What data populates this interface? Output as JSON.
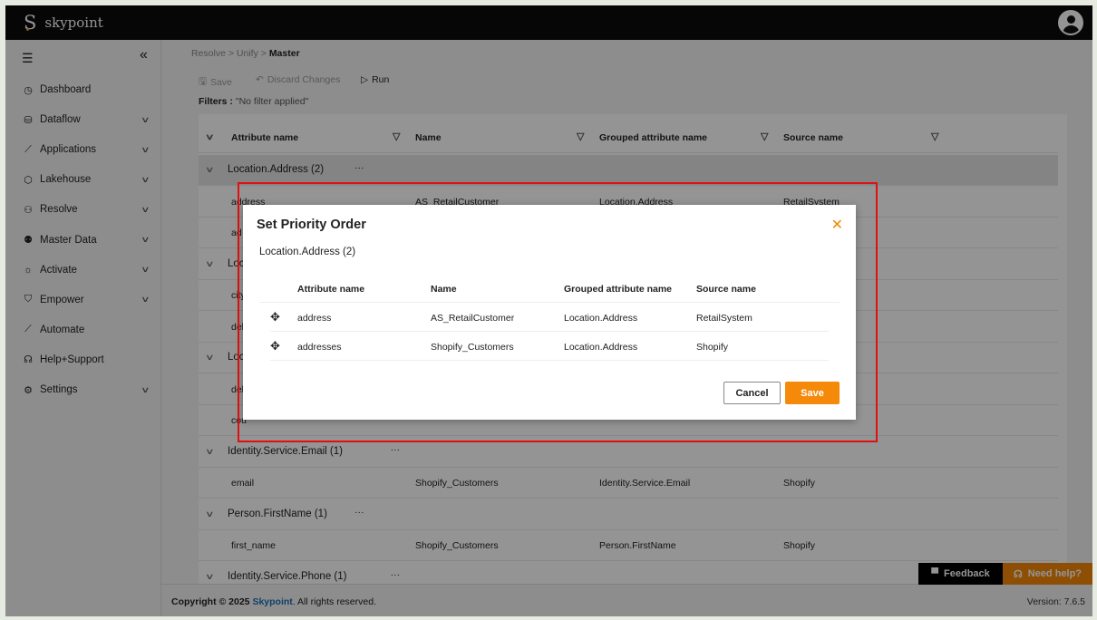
{
  "app": {
    "name": "skypoint",
    "logo_letter": "S"
  },
  "sidebar": {
    "items": [
      {
        "label": "Dashboard",
        "icon": "gauge-icon",
        "glyph": "◷",
        "chevron": false
      },
      {
        "label": "Dataflow",
        "icon": "database-icon",
        "glyph": "⛁",
        "chevron": true
      },
      {
        "label": "Applications",
        "icon": "connector-icon",
        "glyph": "⟋",
        "chevron": true
      },
      {
        "label": "Lakehouse",
        "icon": "cube-icon",
        "glyph": "⬡",
        "chevron": true
      },
      {
        "label": "Resolve",
        "icon": "hierarchy-icon",
        "glyph": "⚇",
        "chevron": true
      },
      {
        "label": "Master Data",
        "icon": "people-icon",
        "glyph": "⚉",
        "chevron": true
      },
      {
        "label": "Activate",
        "icon": "lightbulb-icon",
        "glyph": "☼",
        "chevron": true
      },
      {
        "label": "Empower",
        "icon": "shield-icon",
        "glyph": "⛉",
        "chevron": true
      },
      {
        "label": "Automate",
        "icon": "connector-icon",
        "glyph": "⟋",
        "chevron": false
      },
      {
        "label": "Help+Support",
        "icon": "headset-icon",
        "glyph": "☊",
        "chevron": false
      },
      {
        "label": "Settings",
        "icon": "gear-icon",
        "glyph": "⚙",
        "chevron": true
      }
    ]
  },
  "breadcrumb": {
    "items": [
      "Resolve",
      "Unify"
    ],
    "current": "Master"
  },
  "toolbar": {
    "save": "Save",
    "discard": "Discard Changes",
    "run": "Run"
  },
  "filters": {
    "label": "Filters :",
    "value": "\"No filter applied\""
  },
  "table": {
    "columns": [
      "Attribute name",
      "Name",
      "Grouped attribute name",
      "Source name"
    ],
    "rows": [
      {
        "type": "group",
        "label": "Location.Address (2)"
      },
      {
        "type": "row",
        "cells": [
          "address",
          "AS_RetailCustomer",
          "Location.Address",
          "RetailSystem"
        ]
      },
      {
        "type": "row",
        "cells": [
          "ad",
          "",
          "",
          ""
        ]
      },
      {
        "type": "group",
        "label": "Loc"
      },
      {
        "type": "row",
        "cells": [
          "city",
          "",
          "",
          ""
        ]
      },
      {
        "type": "row",
        "cells": [
          "del",
          "",
          "",
          ""
        ]
      },
      {
        "type": "group",
        "label": "Loc"
      },
      {
        "type": "row",
        "cells": [
          "del",
          "",
          "",
          ""
        ]
      },
      {
        "type": "row",
        "cells": [
          "cou",
          "",
          "",
          ""
        ]
      },
      {
        "type": "group",
        "label": "Identity.Service.Email (1)"
      },
      {
        "type": "row",
        "cells": [
          "email",
          "Shopify_Customers",
          "Identity.Service.Email",
          "Shopify"
        ]
      },
      {
        "type": "group",
        "label": "Person.FirstName (1)"
      },
      {
        "type": "row",
        "cells": [
          "first_name",
          "Shopify_Customers",
          "Person.FirstName",
          "Shopify"
        ]
      },
      {
        "type": "group",
        "label": "Identity.Service.Phone (1)"
      }
    ]
  },
  "modal": {
    "title": "Set Priority Order",
    "subtitle": "Location.Address (2)",
    "columns": [
      "Attribute name",
      "Name",
      "Grouped attribute name",
      "Source name"
    ],
    "rows": [
      [
        "address",
        "AS_RetailCustomer",
        "Location.Address",
        "RetailSystem"
      ],
      [
        "addresses",
        "Shopify_Customers",
        "Location.Address",
        "Shopify"
      ]
    ],
    "cancel": "Cancel",
    "save": "Save"
  },
  "footer": {
    "copyright_prefix": "Copyright © 2025 ",
    "brand": "Skypoint",
    "copyright_suffix": ". All rights reserved.",
    "version": "Version: 7.6.5"
  },
  "widgets": {
    "feedback": "Feedback",
    "help": "Need help?"
  },
  "colors": {
    "accent": "#f5890a",
    "highlight": "#e01010",
    "link": "#1a6fb5"
  }
}
